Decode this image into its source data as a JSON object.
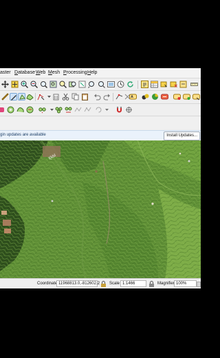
{
  "menubar": {
    "items": [
      {
        "label": "aster",
        "accel": "",
        "rest": ""
      },
      {
        "label": "Database",
        "accel": "D",
        "rest": "atabase"
      },
      {
        "label": "Web",
        "accel": "W",
        "rest": "eb"
      },
      {
        "label": "Mesh",
        "accel": "M",
        "rest": "esh"
      },
      {
        "label": "Processing",
        "accel": "P",
        "rest": "rocessing"
      },
      {
        "label": "Help",
        "accel": "H",
        "rest": "elp"
      }
    ]
  },
  "toolbar": {
    "font_size_value": "12",
    "unit_value": "px"
  },
  "message_bar": {
    "text": "gin updates are available",
    "install_button": "Install Updates..."
  },
  "map": {
    "label_fragment": "l(kbl"
  },
  "statusbar": {
    "coordinate_label": "Coordinate",
    "coordinate_value": "11968813.0,-812602.2",
    "scale_label": "Scale",
    "scale_value": "1:1466",
    "magnifier_label": "Magnifier",
    "magnifier_value": "100%"
  },
  "colors": {
    "map_green": "#5f8f36",
    "message_bar_bg": "#eaf2fb",
    "toolbar_bg": "#efefef"
  }
}
